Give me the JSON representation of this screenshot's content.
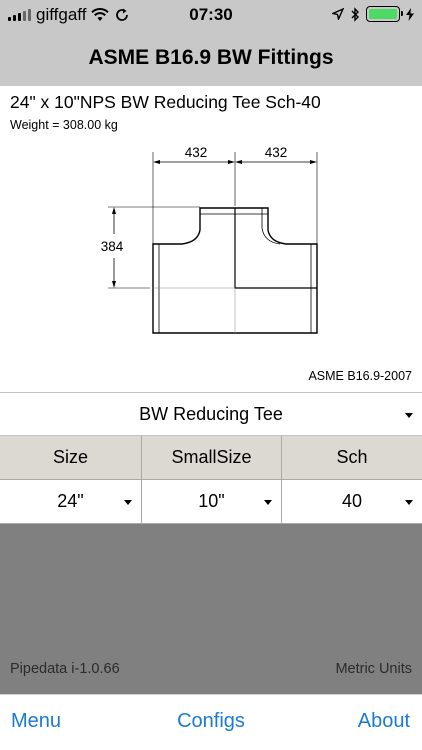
{
  "status_bar": {
    "carrier": "giffgaff",
    "time": "07:30",
    "battery_color": "#4cd964"
  },
  "nav": {
    "title": "ASME B16.9 BW Fittings"
  },
  "fitting": {
    "title": "24\" x 10\"NPS BW Reducing Tee Sch-40",
    "weight": "Weight = 308.00 kg",
    "standard": "ASME B16.9-2007"
  },
  "drawing": {
    "dim_left_half": "432",
    "dim_right_half": "432",
    "dim_height": "384"
  },
  "type_selector": {
    "value": "BW Reducing Tee"
  },
  "grid": {
    "headers": [
      "Size",
      "SmallSize",
      "Sch"
    ],
    "values": [
      "24\"",
      "10\"",
      "40"
    ]
  },
  "footer": {
    "version": "Pipedata i-1.0.66",
    "units": "Metric Units"
  },
  "tabs": {
    "menu": "Menu",
    "configs": "Configs",
    "about": "About"
  },
  "colors": {
    "bar_grey": "#c8c8c8",
    "panel_grey": "#808080",
    "link_blue": "#1a7bd6"
  }
}
